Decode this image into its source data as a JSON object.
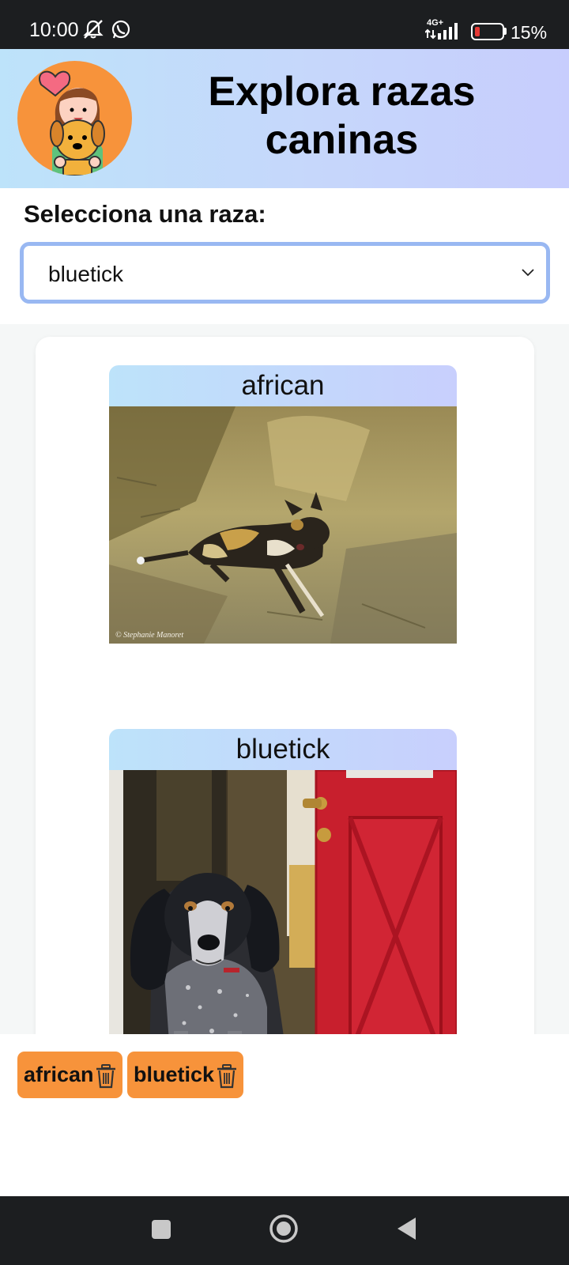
{
  "status_bar": {
    "time": "10:00",
    "network": "4G+",
    "battery_percent": "15%",
    "battery_level": 0.15,
    "icons": [
      "mute-icon",
      "whatsapp-icon",
      "signal-icon",
      "battery-icon"
    ]
  },
  "header": {
    "title": "Explora razas caninas",
    "avatar_icon": "girl-with-dog-icon"
  },
  "breed_select": {
    "label": "Selecciona una raza:",
    "selected": "bluetick"
  },
  "gallery": {
    "cards": [
      {
        "breed": "african",
        "photo_credit": "© Stephanie Manoret"
      },
      {
        "breed": "bluetick"
      }
    ]
  },
  "chips": [
    {
      "label": "african",
      "icon": "trash-icon"
    },
    {
      "label": "bluetick",
      "icon": "trash-icon"
    }
  ],
  "nav_bar": {
    "buttons": [
      "recents-button",
      "home-button",
      "back-button"
    ]
  },
  "colors": {
    "accent_orange": "#f7933b",
    "header_gradient_start": "#bde3fa",
    "header_gradient_end": "#c7cdfd",
    "select_border": "#99b8f2",
    "system_bar": "#1c1e20"
  }
}
